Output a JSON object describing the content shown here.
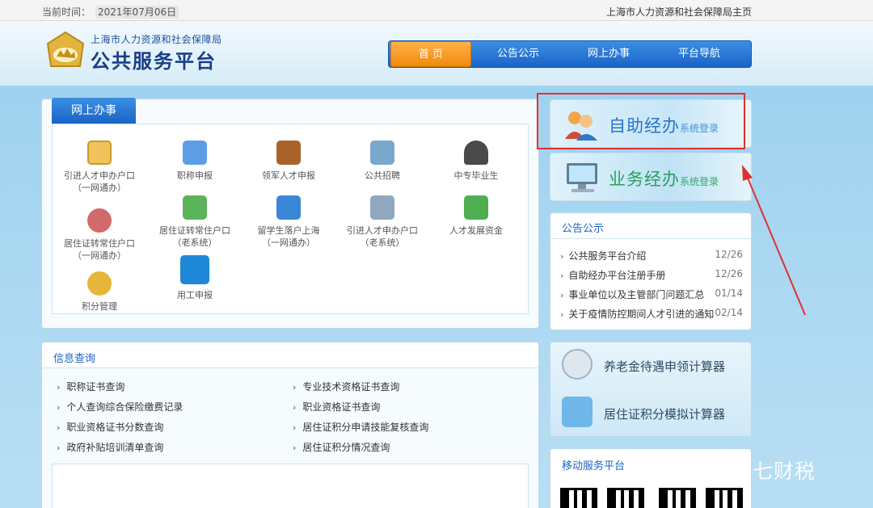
{
  "topbar": {
    "time_label": "当前时间：",
    "date": "2021年07月06日",
    "home_link": "上海市人力资源和社会保障局主页"
  },
  "header": {
    "org_name": "上海市人力资源和社会保障局",
    "platform_name": "公共服务平台"
  },
  "nav": {
    "items": [
      "首 页",
      "公告公示",
      "网上办事",
      "平台导航"
    ],
    "active_index": 0
  },
  "online": {
    "tab_label": "网上办事",
    "services": [
      {
        "line1": "引进人才申办户口",
        "line2": "（一网通办）",
        "icon": "document-icon",
        "color": "#f1c25a"
      },
      {
        "line1": "职称申报",
        "line2": "",
        "icon": "certificate-icon",
        "color": "#5c9ee6"
      },
      {
        "line1": "领军人才申报",
        "line2": "",
        "icon": "briefcase-icon",
        "color": "#a9632a"
      },
      {
        "line1": "公共招聘",
        "line2": "",
        "icon": "recruit-icon",
        "color": "#7aa7cc"
      },
      {
        "line1": "中专毕业生",
        "line2": "",
        "icon": "graduate-icon",
        "color": "#4a4a4a"
      },
      {
        "line1": "居住证转常住户口",
        "line2": "（一网通办）",
        "icon": "people-icon",
        "color": "#d36a6a"
      },
      {
        "line1": "居住证转常住户口",
        "line2": "（老系统）",
        "icon": "house-icon",
        "color": "#5bb35b"
      },
      {
        "line1": "留学生落户上海",
        "line2": "（一网通办）",
        "icon": "files-icon",
        "color": "#3c86d8"
      },
      {
        "line1": "引进人才申办户口",
        "line2": "（老系统）",
        "icon": "form-icon",
        "color": "#8fa7bf"
      },
      {
        "line1": "人才发展资金",
        "line2": "",
        "icon": "money-icon",
        "color": "#4fae4f"
      },
      {
        "line1": "积分管理",
        "line2": "",
        "icon": "coins-icon",
        "color": "#e6b53a"
      },
      {
        "line1": "用工申报",
        "line2": "",
        "icon": "list-icon",
        "color": "#1e88d8"
      }
    ]
  },
  "info": {
    "title": "信息查询",
    "left_links": [
      "职称证书查询",
      "个人查询综合保险缴费记录",
      "职业资格证书分数查询",
      "政府补贴培训清单查询"
    ],
    "right_links": [
      "专业技术资格证书查询",
      "职业资格证书查询",
      "居住证积分申请技能复核查询",
      "居住证积分情况查询"
    ]
  },
  "banners": {
    "self_service_title": "自助经办",
    "self_service_sub": "系统登录",
    "business_title": "业务经办",
    "business_sub": "系统登录"
  },
  "notice": {
    "title": "公告公示",
    "items": [
      {
        "text": "公共服务平台介绍",
        "date": "12/26"
      },
      {
        "text": "自助经办平台注册手册",
        "date": "12/26"
      },
      {
        "text": "事业单位以及主管部门问题汇总",
        "date": "01/14"
      },
      {
        "text": "关于疫情防控期间人才引进的通知",
        "date": "02/14"
      }
    ]
  },
  "calculators": {
    "pension": "养老金待遇申领计算器",
    "residence": "居住证积分模拟计算器"
  },
  "mobile": {
    "title": "移动服务平台"
  },
  "watermark": "知乎 @七七财税",
  "colors": {
    "accent_blue": "#1a63c6",
    "active_orange": "#f08a0c",
    "annotation_red": "#e03030"
  }
}
